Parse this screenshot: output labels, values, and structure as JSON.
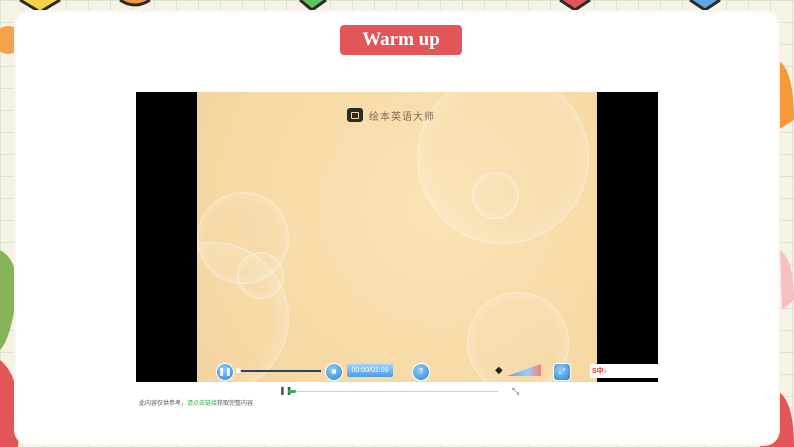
{
  "slide": {
    "title": "Warm up",
    "title_color": "#e25559"
  },
  "video": {
    "watermark_text": "绘本英语大师",
    "background_color": "#f6d9a4",
    "time_display": "00:00/01:09",
    "tray_label": "S中♪"
  },
  "outer_controls": {
    "pause_icon": "pause-icon",
    "expand_icon": "expand-icon",
    "progress": 0.03
  },
  "caption": {
    "prefix": "此内容仅供参考，",
    "highlight": "请点击链接",
    "suffix": "获取完整内容"
  }
}
